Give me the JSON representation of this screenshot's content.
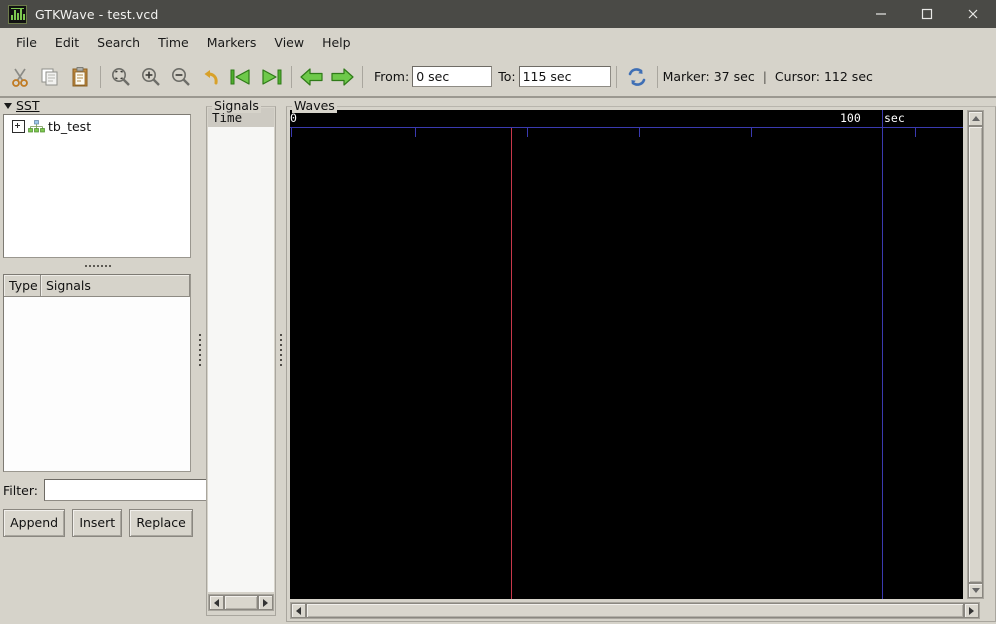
{
  "window": {
    "title": "GTKWave - test.vcd",
    "app_icon": "gtkwave-icon",
    "controls": {
      "minimize": "minimize-icon",
      "maximize": "maximize-icon",
      "close": "close-icon"
    },
    "titlebar_color": "#4a4a46"
  },
  "menubar": {
    "items": [
      {
        "label": "File"
      },
      {
        "label": "Edit"
      },
      {
        "label": "Search"
      },
      {
        "label": "Time"
      },
      {
        "label": "Markers"
      },
      {
        "label": "View"
      },
      {
        "label": "Help"
      }
    ]
  },
  "toolbar": {
    "buttons": [
      {
        "name": "cut-icon"
      },
      {
        "name": "copy-icon"
      },
      {
        "name": "paste-icon"
      },
      {
        "name": "zoom-fit-icon"
      },
      {
        "name": "zoom-in-icon"
      },
      {
        "name": "zoom-out-icon"
      },
      {
        "name": "undo-icon"
      },
      {
        "name": "goto-start-icon"
      },
      {
        "name": "goto-end-icon"
      },
      {
        "name": "back-arrow-icon"
      },
      {
        "name": "forward-arrow-icon"
      },
      {
        "name": "reload-icon"
      }
    ],
    "from_label": "From:",
    "from_value": "0 sec",
    "to_label": "To:",
    "to_value": "115 sec",
    "marker_status": "Marker: 37 sec",
    "status_separator": "|",
    "cursor_status": "Cursor: 112 sec"
  },
  "sst": {
    "frame_label": "SST",
    "tree_items": [
      {
        "label": "tb_test",
        "expanded": false
      }
    ]
  },
  "signals_table": {
    "columns": [
      "Type",
      "Signals"
    ],
    "rows": []
  },
  "filter": {
    "label": "Filter:",
    "value": "",
    "placeholder": ""
  },
  "action_buttons": [
    {
      "label": "Append"
    },
    {
      "label": "Insert"
    },
    {
      "label": "Replace"
    }
  ],
  "signals_panel": {
    "frame_label": "Signals",
    "rows": [
      {
        "label": "Time",
        "selected": true
      }
    ]
  },
  "waves_panel": {
    "frame_label": "Waves",
    "time_labels": {
      "start": "0",
      "hundred": "100",
      "unit": "sec"
    },
    "marker_color": "#c8384a",
    "cursor_color": "#3a3ab0",
    "background": "#000000"
  }
}
